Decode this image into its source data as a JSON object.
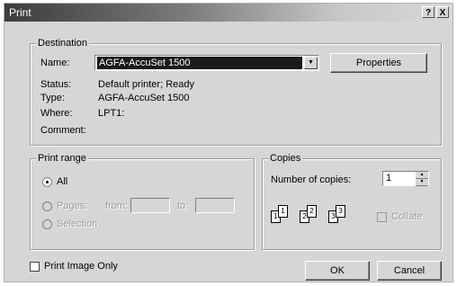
{
  "window": {
    "title": "Print",
    "help": "?",
    "close": "X"
  },
  "destination": {
    "legend": "Destination",
    "name_label": "Name:",
    "name_value": "AGFA-AccuSet 1500",
    "properties_button": "Properties",
    "status_label": "Status:",
    "status_value": "Default printer; Ready",
    "type_label": "Type:",
    "type_value": "AGFA-AccuSet 1500",
    "where_label": "Where:",
    "where_value": "LPT1:",
    "comment_label": "Comment:",
    "comment_value": ""
  },
  "print_range": {
    "legend": "Print range",
    "all_label": "All",
    "pages_label": "Pages:",
    "from_label": "from:",
    "to_label": "to:",
    "from_value": "",
    "to_value": "",
    "selection_label": "Selection",
    "selected": "All"
  },
  "copies": {
    "legend": "Copies",
    "number_label": "Number of copies:",
    "number_value": "1",
    "collate_label": "Collate",
    "collate_checked": false,
    "collate_icon_pages": [
      "1",
      "1",
      "2",
      "2",
      "3",
      "3"
    ]
  },
  "print_image_only": {
    "label": "Print Image Only",
    "checked": false
  },
  "buttons": {
    "ok": "OK",
    "cancel": "Cancel"
  }
}
